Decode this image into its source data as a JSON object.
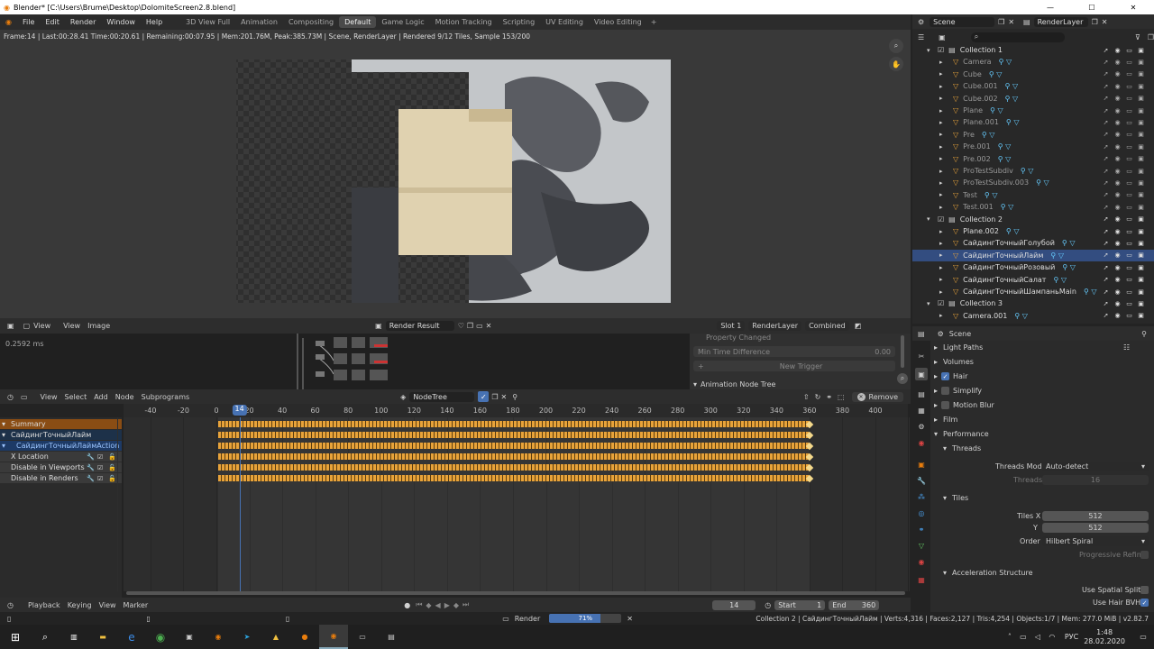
{
  "window": {
    "title": "Blender* [C:\\Users\\Brume\\Desktop\\DolomiteScreen2.8.blend]",
    "min": "—",
    "max": "☐",
    "close": "✕"
  },
  "menus": [
    "File",
    "Edit",
    "Render",
    "Window",
    "Help"
  ],
  "workspaces": [
    {
      "label": "3D View Full"
    },
    {
      "label": "Animation"
    },
    {
      "label": "Compositing"
    },
    {
      "label": "Default",
      "active": true
    },
    {
      "label": "Game Logic"
    },
    {
      "label": "Motion Tracking"
    },
    {
      "label": "Scripting"
    },
    {
      "label": "UV Editing"
    },
    {
      "label": "Video Editing"
    }
  ],
  "add_ws": "+",
  "scene": {
    "label": "Scene",
    "layer": "RenderLayer"
  },
  "render_status": "Frame:14 | Last:00:28.41 Time:00:20.61 | Remaining:00:07.95 | Mem:201.76M, Peak:385.73M | Scene, RenderLayer | Rendered 9/12 Tiles, Sample 153/200",
  "image_editor": {
    "view1": "View",
    "view2": "View",
    "image": "Image",
    "result": "Render Result",
    "slot": "Slot 1",
    "layer": "RenderLayer",
    "pass": "Combined"
  },
  "node_editor": {
    "timing": "0.2592 ms",
    "prop_changed": "Property Changed",
    "min_time": "Min Time Difference",
    "min_time_val": "0.00",
    "new_trigger": "New Trigger",
    "panel_title": "Animation Node Tree"
  },
  "dope": {
    "menus": [
      "View",
      "Select",
      "Add",
      "Node",
      "Subprograms"
    ],
    "tree": "NodeTree",
    "remove": "Remove"
  },
  "ruler": {
    "frame": "14",
    "ticks": [
      "-40",
      "-20",
      "0",
      "20",
      "40",
      "60",
      "80",
      "100",
      "120",
      "140",
      "160",
      "180",
      "200",
      "220",
      "240",
      "260",
      "280",
      "300",
      "320",
      "340",
      "360",
      "380",
      "400"
    ]
  },
  "channels": [
    {
      "label": "Summary",
      "type": "summary"
    },
    {
      "label": "СайдингТочныйЛайм",
      "type": "object"
    },
    {
      "label": "СайдингТочныйЛаймAction",
      "type": "action"
    },
    {
      "label": "X Location",
      "type": "fcurve"
    },
    {
      "label": "Disable in Viewports",
      "type": "fcurve"
    },
    {
      "label": "Disable in Renders",
      "type": "fcurve"
    }
  ],
  "timeline": {
    "playback": "Playback",
    "keying": "Keying",
    "view": "View",
    "marker": "Marker",
    "current": "14",
    "start_label": "Start",
    "start": "1",
    "end_label": "End",
    "end": "360"
  },
  "status": {
    "render_label": "Render",
    "progress": 0.71,
    "progress_label": "71%",
    "info": "Collection 2 | СайдингТочныйЛайм | Verts:4,316 | Faces:2,127 | Tris:4,254 | Objects:1/7 | Mem: 277.0 MiB | v2.82.7"
  },
  "outliner": {
    "scene": "Scene",
    "layer": "RenderLayer",
    "rows": [
      {
        "name": "Collection 1",
        "depth": 1,
        "kind": "collection"
      },
      {
        "name": "Camera",
        "depth": 2,
        "kind": "dim"
      },
      {
        "name": "Cube",
        "depth": 2,
        "kind": "dim"
      },
      {
        "name": "Cube.001",
        "depth": 2,
        "kind": "dim"
      },
      {
        "name": "Cube.002",
        "depth": 2,
        "kind": "dim"
      },
      {
        "name": "Plane",
        "depth": 2,
        "kind": "dim"
      },
      {
        "name": "Plane.001",
        "depth": 2,
        "kind": "dim"
      },
      {
        "name": "Pre",
        "depth": 2,
        "kind": "dim"
      },
      {
        "name": "Pre.001",
        "depth": 2,
        "kind": "dim"
      },
      {
        "name": "Pre.002",
        "depth": 2,
        "kind": "dim"
      },
      {
        "name": "ProTestSubdiv",
        "depth": 2,
        "kind": "dim"
      },
      {
        "name": "ProTestSubdiv.003",
        "depth": 2,
        "kind": "dim"
      },
      {
        "name": "Test",
        "depth": 2,
        "kind": "dim"
      },
      {
        "name": "Test.001",
        "depth": 2,
        "kind": "dim"
      },
      {
        "name": "Collection 2",
        "depth": 1,
        "kind": "collection"
      },
      {
        "name": "Plane.002",
        "depth": 2,
        "kind": "obj"
      },
      {
        "name": "СайдингТочныйГолубой",
        "depth": 2,
        "kind": "obj"
      },
      {
        "name": "СайдингТочныйЛайм",
        "depth": 2,
        "kind": "obj",
        "selected": true
      },
      {
        "name": "СайдингТочныйРозовый",
        "depth": 2,
        "kind": "obj"
      },
      {
        "name": "СайдингТочныйСалат",
        "depth": 2,
        "kind": "obj"
      },
      {
        "name": "СайдингТочныйШампаньMain",
        "depth": 2,
        "kind": "obj"
      },
      {
        "name": "Collection 3",
        "depth": 1,
        "kind": "collection"
      },
      {
        "name": "Camera.001",
        "depth": 2,
        "kind": "obj"
      }
    ]
  },
  "properties": {
    "context": "Scene",
    "sections": {
      "light_paths": "Light Paths",
      "volumes": "Volumes",
      "hair": "Hair",
      "simplify": "Simplify",
      "motion_blur": "Motion Blur",
      "film": "Film",
      "performance": "Performance",
      "threads": "Threads",
      "tiles": "Tiles",
      "accel": "Acceleration Structure"
    },
    "threads_mode_label": "Threads Mode",
    "threads_mode": "Auto-detect",
    "threads_label": "Threads",
    "threads": "16",
    "tiles_x_label": "Tiles X",
    "tiles_x": "512",
    "tiles_y_label": "Y",
    "tiles_y": "512",
    "order_label": "Order",
    "order": "Hilbert Spiral",
    "progressive": "Progressive Refine",
    "spatial": "Use Spatial Splits",
    "hair_bvh": "Use Hair BVH"
  },
  "taskbar": {
    "time": "1:48",
    "date": "28.02.2020",
    "lang": "РУС"
  },
  "colors": {
    "accent": "#4772b3",
    "key": "#e8a33a",
    "summary": "#8a4d14",
    "selected_row": "#334d80"
  }
}
